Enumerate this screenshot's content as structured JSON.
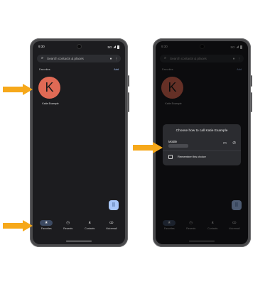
{
  "status": {
    "time": "9:30",
    "network": "5G"
  },
  "search": {
    "placeholder": "Search contacts & places"
  },
  "favorites": {
    "heading": "Favorites",
    "add_label": "Add"
  },
  "contact": {
    "initial": "K",
    "name": "Katie Example"
  },
  "nav": {
    "items": [
      {
        "label": "Favorites",
        "icon": "star-icon"
      },
      {
        "label": "Recents",
        "icon": "clock-icon"
      },
      {
        "label": "Contacts",
        "icon": "people-icon"
      },
      {
        "label": "Voicemail",
        "icon": "voicemail-icon"
      }
    ]
  },
  "dialog": {
    "title": "Choose how to call Katie Example",
    "type_label": "Mobile",
    "remember_label": "Remember this choice"
  },
  "colors": {
    "arrow": "#f6a81a",
    "avatar": "#e06a55",
    "fab": "#a8c7fa",
    "accent": "#a8c7fa"
  }
}
